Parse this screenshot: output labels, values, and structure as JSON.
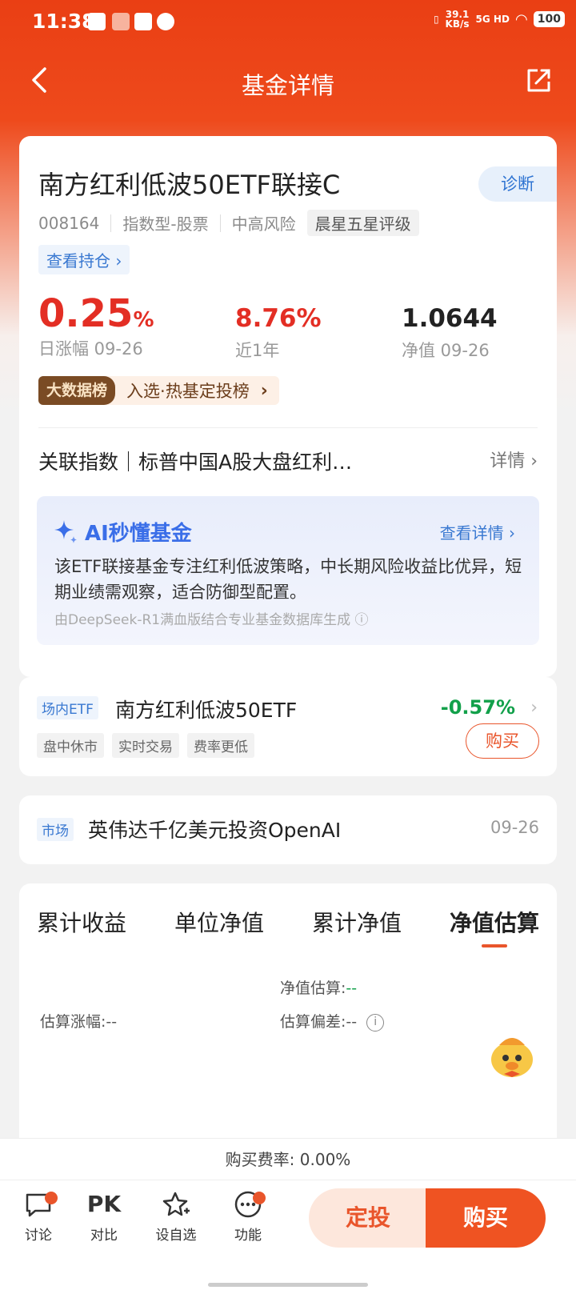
{
  "status_bar": {
    "time": "11:38",
    "net_speed_top": "39.1",
    "net_speed_unit": "KB/s",
    "network": "5G HD",
    "battery": "100"
  },
  "nav": {
    "title": "基金详情"
  },
  "fund": {
    "name": "南方红利低波50ETF联接C",
    "diagnose": "诊断",
    "code": "008164",
    "type": "指数型-股票",
    "risk": "中高风险",
    "rating": "晨星五星评级",
    "holdings_link": "查看持仓 ›",
    "daily_change_value": "0.25",
    "daily_change_unit": "%",
    "daily_change_label": "日涨幅 09-26",
    "year_change": "8.76%",
    "year_change_label": "近1年",
    "nav_value": "1.0644",
    "nav_label": "净值 09-26"
  },
  "ranking": {
    "tag": "大数据榜",
    "text": "入选·热基定投榜",
    "arrow": "›"
  },
  "related_index": {
    "text": "关联指数｜标普中国A股大盘红利…",
    "detail": "详情 ›"
  },
  "ai": {
    "title": "AI秒懂基金",
    "more": "查看详情 ›",
    "summary": "该ETF联接基金专注红利低波策略，中长期风险收益比优异，短期业绩需观察，适合防御型配置。",
    "source": "由DeepSeek-R1满血版结合专业基金数据库生成 ⓘ"
  },
  "etf": {
    "tag": "场内ETF",
    "name": "南方红利低波50ETF",
    "change": "-0.57%",
    "chips": [
      "盘中休市",
      "实时交易",
      "费率更低"
    ],
    "buy": "购买"
  },
  "news": {
    "tag": "市场",
    "title": "英伟达千亿美元投资OpenAI",
    "date": "09-26"
  },
  "tabs": {
    "items": [
      "累计收益",
      "单位净值",
      "累计净值",
      "净值估算"
    ],
    "active": "净值估算"
  },
  "estimate": {
    "nav_est_label": "净值估算:",
    "nav_est_value": "--",
    "est_change_label": "估算涨幅:--",
    "est_dev_label": "估算偏差:--"
  },
  "fee": {
    "text": "购买费率: 0.00%"
  },
  "bottom_bar": {
    "discuss": "讨论",
    "compare_icon": "PK",
    "compare": "对比",
    "watch": "设自选",
    "functions": "功能",
    "dingtou": "定投",
    "buy": "购买"
  },
  "colors": {
    "brand": "#ea3f14",
    "up_red": "#e32e24",
    "down_green": "#12a04a",
    "link_blue": "#3978d1"
  }
}
